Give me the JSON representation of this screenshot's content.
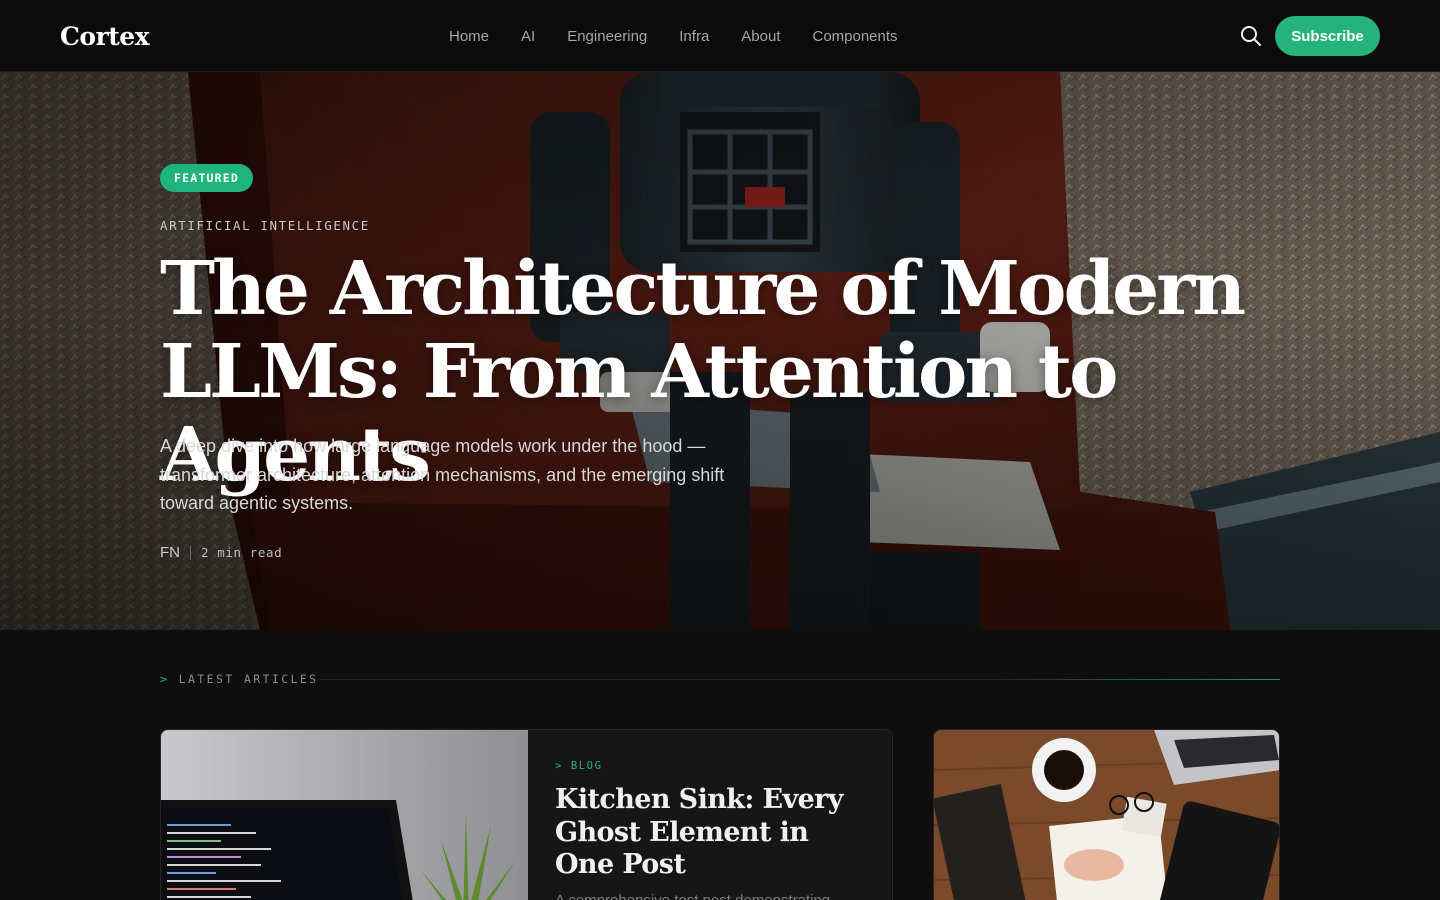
{
  "site": {
    "logo": "Cortex"
  },
  "nav": {
    "items": [
      {
        "label": "Home"
      },
      {
        "label": "AI"
      },
      {
        "label": "Engineering"
      },
      {
        "label": "Infra"
      },
      {
        "label": "About"
      },
      {
        "label": "Components"
      }
    ],
    "subscribe_label": "Subscribe",
    "search_icon": "search-icon"
  },
  "hero": {
    "badge": "FEATURED",
    "category": "ARTIFICIAL INTELLIGENCE",
    "title": "The Architecture of Modern LLMs: From Attention to Agents",
    "excerpt": "A deep dive into how large language models work under the hood — transformer architecture, attention mechanisms, and the emerging shift toward agentic systems.",
    "author": "FN",
    "read_time": "2 min read"
  },
  "latest": {
    "prefix": ">",
    "label": "LATEST ARTICLES"
  },
  "articles": [
    {
      "tag": "> BLOG",
      "title": "Kitchen Sink: Every Ghost Element in One Post",
      "excerpt": "A comprehensive test post demonstrating"
    }
  ],
  "colors": {
    "accent": "#26b27c",
    "background": "#0e0e0e",
    "header": "#0c0c0c"
  }
}
